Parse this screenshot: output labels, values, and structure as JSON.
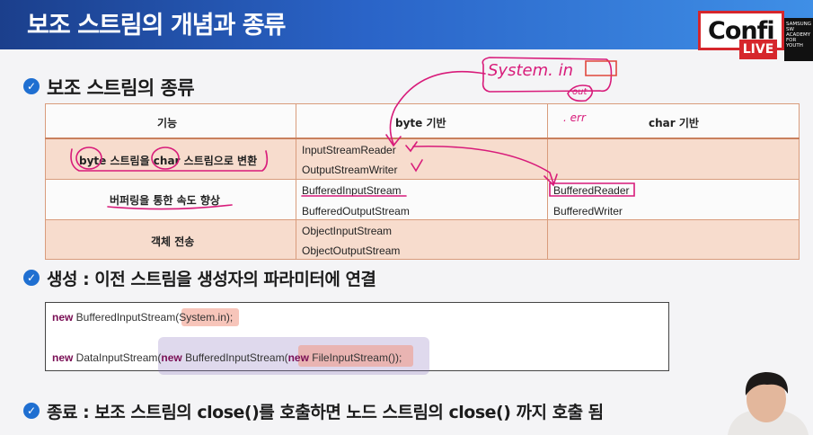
{
  "header": {
    "title": "보조 스트림의 개념과 종류"
  },
  "logo": {
    "text": "Confi",
    "live": "LIVE",
    "academy": "SAMSUNG\nSW\nACADEMY\nFOR\nYOUTH"
  },
  "sections": {
    "types_title": "보조 스트림의 종류",
    "create_title": "생성 : 이전 스트림을 생성자의 파라미터에 연결",
    "close_title": "종료 : 보조 스트림의 close()를 호출하면 노드 스트림의 close() 까지 호출 됨"
  },
  "table": {
    "headers": [
      "기능",
      "byte 기반",
      "char 기반"
    ],
    "rows": [
      {
        "function": "byte 스트림을 char 스트림으로 변환",
        "byte": [
          "InputStreamReader",
          "OutputStreamWriter"
        ],
        "char": [
          "",
          ""
        ]
      },
      {
        "function": "버퍼링을 통한 속도 향상",
        "byte": [
          "BufferedInputStream",
          "BufferedOutputStream"
        ],
        "char": [
          "BufferedReader",
          "BufferedWriter"
        ]
      },
      {
        "function": "객체 전송",
        "byte": [
          "ObjectInputStream",
          "ObjectOutputStream"
        ],
        "char": [
          "",
          ""
        ]
      }
    ]
  },
  "code": {
    "line1": {
      "kw": "new",
      "text1": " BufferedInputStream(",
      "hl": "System.in",
      "text2": ");"
    },
    "line2": {
      "kw1": "new",
      "text1": " DataInputStream(",
      "kw2": "new",
      "text2": " BufferedInputStream(",
      "kw3": "new",
      "text3": " FileInputStream",
      "text4": "());"
    }
  },
  "annotations": {
    "system_in": "System. in",
    "out": "out",
    "err": ". err"
  },
  "colors": {
    "header_blue": "#2a64c8",
    "table_peach": "#f7dccd",
    "table_border": "#d99c7c",
    "ink_pink": "#d81b7a",
    "keyword": "#7a0f55"
  }
}
